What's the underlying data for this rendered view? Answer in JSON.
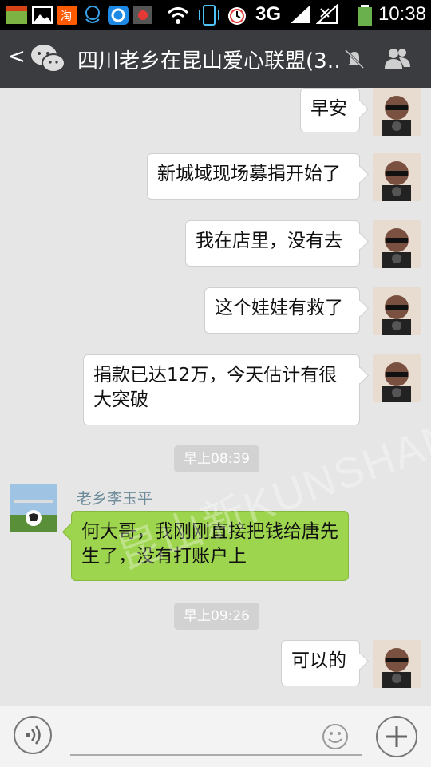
{
  "status_bar": {
    "time": "10:38",
    "network": "3G"
  },
  "header": {
    "title": "四川老乡在昆山爱心联盟(3…"
  },
  "watermark": {
    "text": "昆山新KUNSHAN DIBS"
  },
  "messages": [
    {
      "side": "right",
      "text": "早安"
    },
    {
      "side": "right",
      "text": "新城域现场募捐开始了"
    },
    {
      "side": "right",
      "text": "我在店里，没有去"
    },
    {
      "side": "right",
      "text": "这个娃娃有救了"
    },
    {
      "side": "right",
      "text": "捐款已达12万，今天估计有很大突破"
    },
    {
      "type": "timestamp",
      "text": "早上08:39"
    },
    {
      "side": "left",
      "sender": "老乡李玉平",
      "text": "何大哥，我刚刚直接把钱给唐先生了，没有打账户上"
    },
    {
      "type": "timestamp",
      "text": "早上09:26"
    },
    {
      "side": "right",
      "text": "可以的"
    }
  ],
  "icons": {
    "back": "chevron-left-icon",
    "logo": "wechat-icon",
    "mute": "bell-muted-icon",
    "members": "people-icon",
    "voice": "voice-icon",
    "emoji": "emoji-icon",
    "more": "plus-icon"
  },
  "colors": {
    "titlebar": "#3a3c40",
    "own_bubble": "#ffffff",
    "other_bubble": "#9ed54f",
    "chat_bg": "#e6e6e6"
  }
}
